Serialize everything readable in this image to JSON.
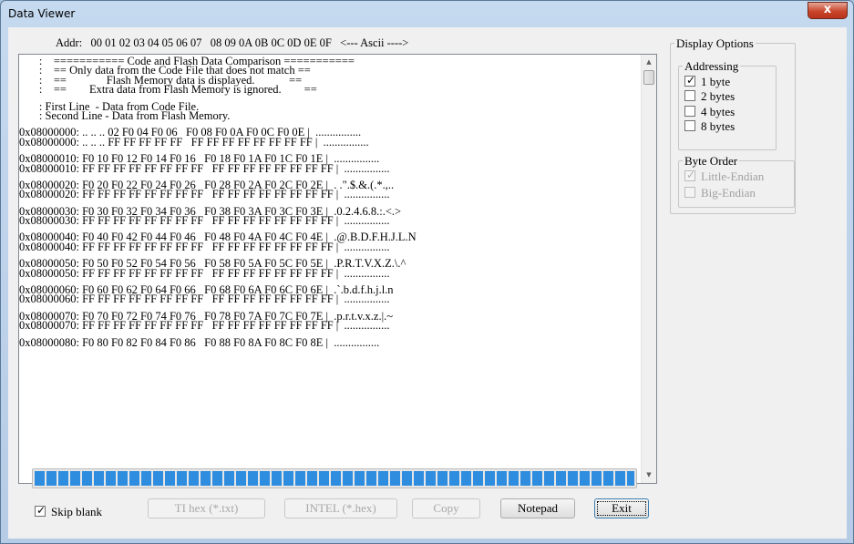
{
  "window": {
    "title": "Data Viewer",
    "close_label": "x"
  },
  "hex_header": "Addr:   00 01 02 03 04 05 06 07   08 09 0A 0B 0C 0D 0E 0F   <--- Ascii ---->",
  "content": {
    "lines": [
      "       :    =========== Code and Flash Data Comparison ===========",
      "       :    == Only data from the Code File that does not match ==",
      "       :    ==              Flash Memory data is displayed.            ==",
      "       :    ==        Extra data from Flash Memory is ignored.        ==",
      "",
      "       : First Line  - Data from Code File.",
      "       : Second Line - Data from Flash Memory.",
      "",
      "0x08000000: .. .. .. 02 F0 04 F0 06   F0 08 F0 0A F0 0C F0 0E |  ................",
      "0x08000000: .. .. .. FF FF FF FF FF   FF FF FF FF FF FF FF FF |  ................",
      "",
      "0x08000010: F0 10 F0 12 F0 14 F0 16   F0 18 F0 1A F0 1C F0 1E |  ................",
      "0x08000010: FF FF FF FF FF FF FF FF   FF FF FF FF FF FF FF FF |  ................",
      "",
      "0x08000020: F0 20 F0 22 F0 24 F0 26   F0 28 F0 2A F0 2C F0 2E |  . .\".$.&.(.*.,..",
      "0x08000020: FF FF FF FF FF FF FF FF   FF FF FF FF FF FF FF FF |  ................",
      "",
      "0x08000030: F0 30 F0 32 F0 34 F0 36   F0 38 F0 3A F0 3C F0 3E |  .0.2.4.6.8.:.<.>",
      "0x08000030: FF FF FF FF FF FF FF FF   FF FF FF FF FF FF FF FF |  ................",
      "",
      "0x08000040: F0 40 F0 42 F0 44 F0 46   F0 48 F0 4A F0 4C F0 4E |  .@.B.D.F.H.J.L.N",
      "0x08000040: FF FF FF FF FF FF FF FF   FF FF FF FF FF FF FF FF |  ................",
      "",
      "0x08000050: F0 50 F0 52 F0 54 F0 56   F0 58 F0 5A F0 5C F0 5E |  .P.R.T.V.X.Z.\\.^",
      "0x08000050: FF FF FF FF FF FF FF FF   FF FF FF FF FF FF FF FF |  ................",
      "",
      "0x08000060: F0 60 F0 62 F0 64 F0 66   F0 68 F0 6A F0 6C F0 6E |  .`.b.d.f.h.j.l.n",
      "0x08000060: FF FF FF FF FF FF FF FF   FF FF FF FF FF FF FF FF |  ................",
      "",
      "0x08000070: F0 70 F0 72 F0 74 F0 76   F0 78 F0 7A F0 7C F0 7E |  .p.r.t.v.x.z.|.~",
      "0x08000070: FF FF FF FF FF FF FF FF   FF FF FF FF FF FF FF FF |  ................",
      "",
      "0x08000080: F0 80 F0 82 F0 84 F0 86   F0 88 F0 8A F0 8C F0 8E |  ................"
    ]
  },
  "progress": {
    "percent": 100,
    "color": "#2f8de0"
  },
  "display_options": {
    "title": "Display Options",
    "addressing": {
      "title": "Addressing",
      "options": [
        {
          "label": "1 byte",
          "checked": true
        },
        {
          "label": "2 bytes",
          "checked": false
        },
        {
          "label": "4 bytes",
          "checked": false
        },
        {
          "label": "8 bytes",
          "checked": false
        }
      ]
    },
    "byte_order": {
      "title": "Byte Order",
      "options": [
        {
          "label": "Little-Endian",
          "checked": true,
          "disabled": true
        },
        {
          "label": "Big-Endian",
          "checked": false,
          "disabled": true
        }
      ]
    }
  },
  "skip_blank": {
    "label": "Skip blank",
    "checked": true
  },
  "buttons": {
    "ti_hex": "TI hex (*.txt)",
    "intel": "INTEL (*.hex)",
    "copy": "Copy",
    "notepad": "Notepad",
    "exit": "Exit"
  },
  "icons": {
    "check": "✓",
    "scroll_up": "▲",
    "scroll_down": "▼"
  }
}
